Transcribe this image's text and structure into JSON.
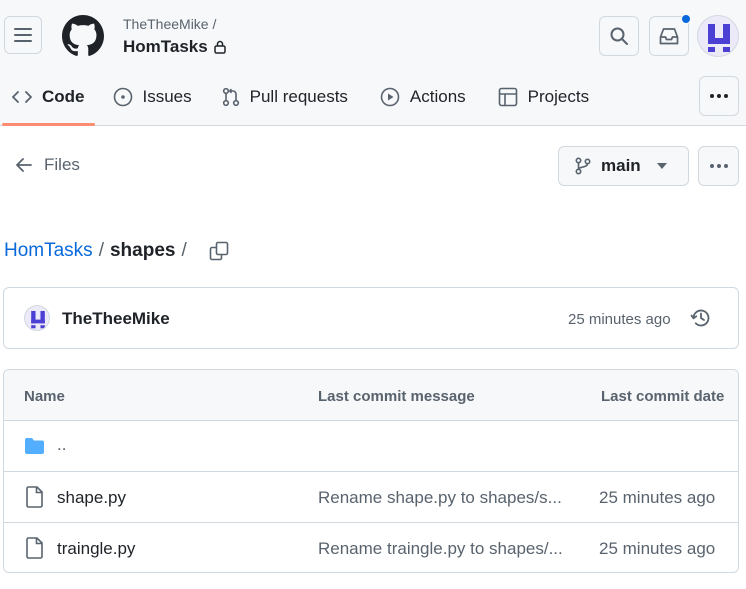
{
  "header": {
    "owner": "TheTheeMike /",
    "repo": "HomTasks"
  },
  "tabs": [
    {
      "label": "Code",
      "icon": "code-icon"
    },
    {
      "label": "Issues",
      "icon": "issue-icon"
    },
    {
      "label": "Pull requests",
      "icon": "pull-request-icon"
    },
    {
      "label": "Actions",
      "icon": "play-icon"
    },
    {
      "label": "Projects",
      "icon": "table-icon"
    }
  ],
  "files_nav": {
    "label": "Files",
    "branch": "main"
  },
  "breadcrumb": {
    "root": "HomTasks",
    "sep1": "/",
    "current": "shapes",
    "sep2": "/"
  },
  "latest_commit": {
    "author": "TheTheeMike",
    "time": "25 minutes ago"
  },
  "table": {
    "headers": {
      "name": "Name",
      "message": "Last commit message",
      "date": "Last commit date"
    },
    "parent_label": "..",
    "rows": [
      {
        "name": "shape.py",
        "message": "Rename shape.py to shapes/s...",
        "date": "25 minutes ago"
      },
      {
        "name": "traingle.py",
        "message": "Rename traingle.py to shapes/...",
        "date": "25 minutes ago"
      }
    ]
  },
  "colors": {
    "accent_link": "#0969da",
    "tab_underline": "#fd8c73",
    "folder": "#54aeff",
    "notification_dot": "#0969da",
    "avatar": "#4b3fd4"
  }
}
